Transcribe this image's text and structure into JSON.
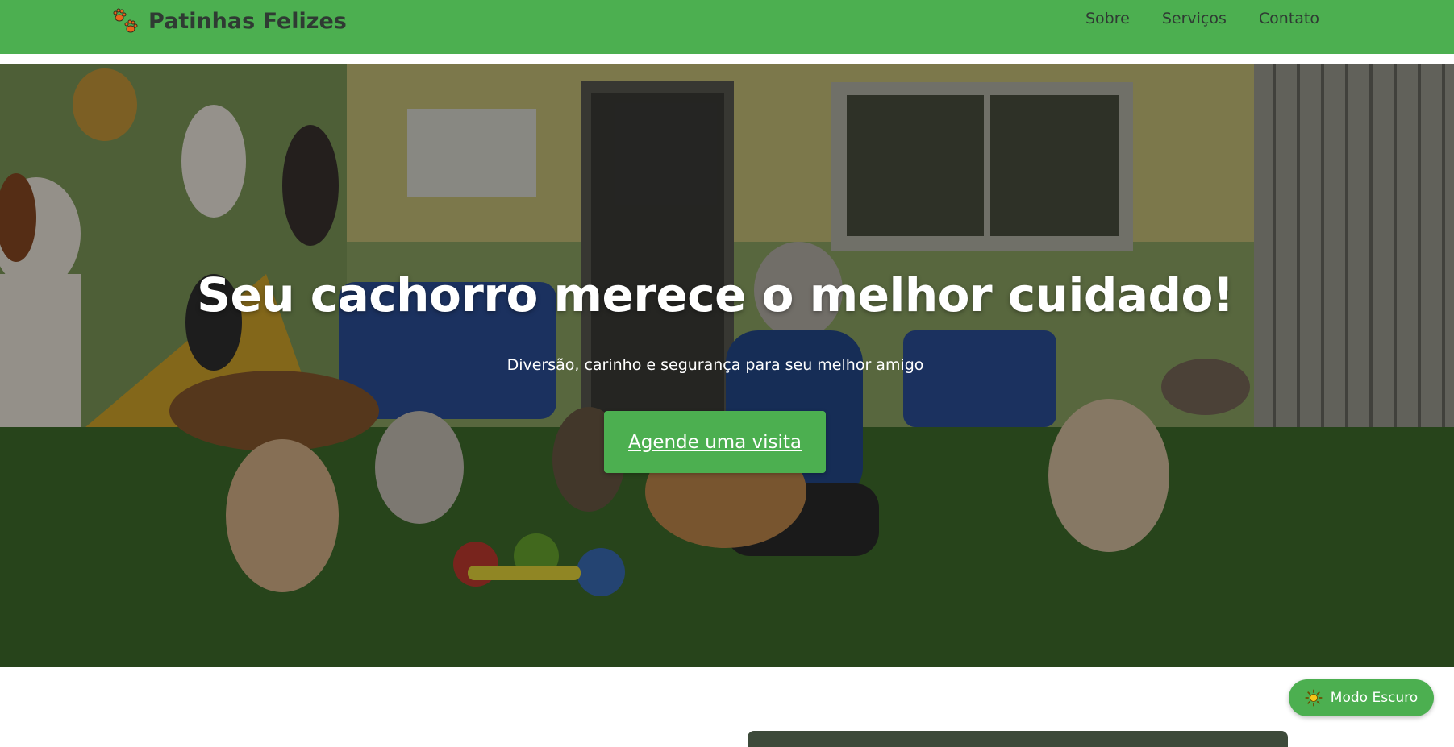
{
  "header": {
    "brand": "Patinhas Felizes",
    "nav": [
      "Sobre",
      "Serviços",
      "Contato"
    ]
  },
  "hero": {
    "title": "Seu cachorro merece o melhor cuidado!",
    "subtitle": "Diversão, carinho e segurança para seu melhor amigo",
    "cta": "Agende uma visita"
  },
  "theme_toggle": {
    "label": "Modo Escuro",
    "icon": "sun-icon"
  },
  "colors": {
    "brand_green": "#4caf50",
    "text_dark": "#2f3a33",
    "white": "#ffffff"
  },
  "icons": {
    "brand": "paw-prints-icon"
  }
}
